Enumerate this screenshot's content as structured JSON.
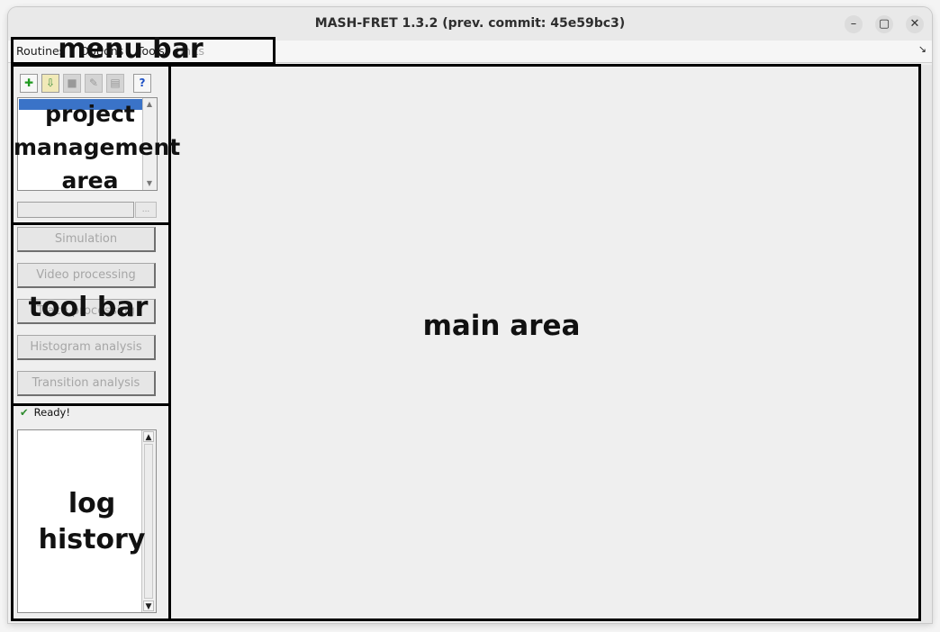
{
  "window": {
    "title": "MASH-FRET 1.3.2 (prev. commit: 45e59bc3)"
  },
  "window_controls": {
    "minimize": "–",
    "maximize": "▢",
    "close": "✕"
  },
  "menubar": {
    "items": [
      "Routines",
      "Options",
      "Tools",
      "Units"
    ],
    "corner_glyph": "↘"
  },
  "project_toolbar": {
    "buttons": [
      {
        "name": "new-project-icon",
        "glyph": "✚"
      },
      {
        "name": "import-project-icon",
        "glyph": "⇩"
      },
      {
        "name": "close-project-icon",
        "glyph": "■"
      },
      {
        "name": "edit-project-icon",
        "glyph": "✎"
      },
      {
        "name": "save-project-icon",
        "glyph": "▤"
      },
      {
        "name": "help-icon",
        "glyph": "?"
      }
    ],
    "path_button": "..."
  },
  "modules": [
    "Simulation",
    "Video processing",
    "Trace processing",
    "Histogram analysis",
    "Transition analysis"
  ],
  "status": {
    "check": "✔",
    "text": "Ready!"
  },
  "scroll": {
    "up": "▲",
    "down": "▼"
  },
  "annotations": {
    "menu_bar": "menu bar",
    "project_area": [
      "project",
      "management",
      "area"
    ],
    "tool_bar": "tool bar",
    "log_history": "log history",
    "main_area": "main area"
  },
  "colors": {
    "selection": "#3a73c8",
    "status_ok": "#2e8b2e",
    "annotation_frame": "#000000"
  }
}
